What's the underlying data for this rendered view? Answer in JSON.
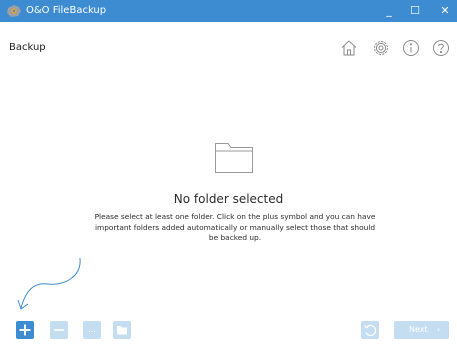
{
  "window": {
    "title": "O&O FileBackup",
    "minimize_glyph": "_",
    "maximize_glyph": "☐",
    "close_glyph": "✕"
  },
  "header": {
    "title": "Backup",
    "icons": [
      "home-icon",
      "gear-icon",
      "info-icon",
      "help-icon"
    ]
  },
  "empty_state": {
    "title": "No folder selected",
    "message": "Please select at least one folder. Click on the plus symbol and you can have important folders added automatically or manually select those that should be backed up.",
    "icon": "folder-icon"
  },
  "toolbar": {
    "add_icon": "plus-icon",
    "remove_icon": "minus-icon",
    "more_label": "...",
    "folder_icon": "folder-icon",
    "undo_icon": "undo-icon",
    "next_label": "Next",
    "next_chevron": "›"
  },
  "colors": {
    "accent": "#3d8bd0",
    "disabled": "#c5ddf1",
    "icon_gray": "#8a8a8a"
  }
}
